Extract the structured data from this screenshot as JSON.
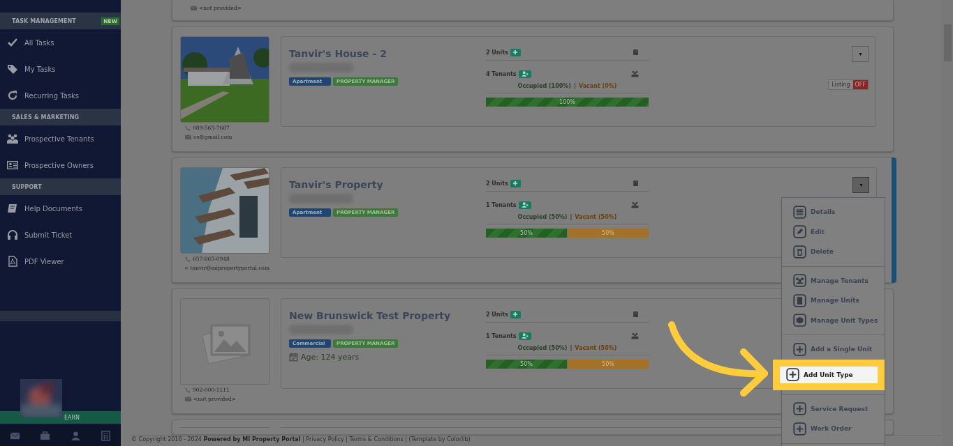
{
  "sidebar": {
    "sections": [
      {
        "heading": "TASK MANAGEMENT",
        "badge": "NEW",
        "items": [
          "All Tasks",
          "My Tasks",
          "Recurring Tasks"
        ]
      },
      {
        "heading": "SALES & MARKETING",
        "items": [
          "Prospective Tenants",
          "Prospective Owners"
        ]
      },
      {
        "heading": "SUPPORT",
        "items": [
          "Help Documents",
          "Submit Ticket",
          "PDF Viewer"
        ]
      }
    ],
    "earn_bar": "EARN"
  },
  "partial_card": {
    "email": "<not provided>"
  },
  "properties": [
    {
      "title": "Tanvir's House - 2",
      "photo": {
        "kind": "picture"
      },
      "phone": "089-565-7687",
      "email": "os@gmail.com",
      "tags": [
        {
          "label": "Apartment",
          "kind": "type"
        },
        {
          "label": "PROPERTY MANAGER",
          "kind": "role"
        }
      ],
      "units": "2 Units",
      "tenants": "4 Tenants",
      "occupied": "Occupied (100%)",
      "separator": "|",
      "vacant": "Vacant (0%)",
      "segments": [
        {
          "label": "100%",
          "kind": "occupied",
          "level": 1
        }
      ],
      "listing": {
        "label": "Listing",
        "state": "OFF"
      },
      "menu_open": false
    },
    {
      "title": "Tanvir's Property",
      "photo": {
        "kind": "picture"
      },
      "phone": "657-865-0948",
      "email": "tanvir@mipropertyportal.com",
      "tags": [
        {
          "label": "Apartment",
          "kind": "type"
        },
        {
          "label": "PROPERTY MANAGER",
          "kind": "role"
        }
      ],
      "units": "2 Units",
      "tenants": "1 Tenants",
      "occupied": "Occupied (50%)",
      "separator": "|",
      "vacant": "Vacant (50%)",
      "segments": [
        {
          "label": "50%",
          "kind": "occupied",
          "level": 0.5
        },
        {
          "label": "50%",
          "kind": "vacant",
          "level": 0.5
        }
      ],
      "menu_open": true
    },
    {
      "title": "New Brunswick Test Property",
      "phone": "902-000-1111",
      "email": "<not provided>",
      "tags": [
        {
          "label": "Commercial",
          "kind": "type"
        },
        {
          "label": "PROPERTY MANAGER",
          "kind": "role"
        }
      ],
      "age": "Age: 124 years",
      "units": "2 Units",
      "tenants": "1 Tenants",
      "occupied": "Occupied (50%)",
      "separator": "|",
      "vacant": "Vacant (50%)",
      "segments": [
        {
          "label": "50%",
          "kind": "occupied",
          "level": 0.5
        },
        {
          "label": "50%",
          "kind": "vacant",
          "level": 0.5
        }
      ]
    }
  ],
  "action_menu": {
    "groups": [
      [
        {
          "label": "Details",
          "selected": false
        },
        {
          "label": "Edit",
          "selected": false
        },
        {
          "label": "Delete",
          "selected": false
        }
      ],
      [
        {
          "label": "Manage Tenants",
          "selected": false
        },
        {
          "label": "Manage Units",
          "selected": false
        },
        {
          "label": "Manage Unit Types",
          "selected": false
        }
      ],
      [
        {
          "label": "Add a Single Unit",
          "selected": false
        },
        {
          "label": "Add Unit Type",
          "selected": true
        }
      ],
      [
        {
          "label": "Service Request",
          "selected": false
        },
        {
          "label": "Work Order",
          "selected": false
        }
      ]
    ]
  },
  "footer": "© Copyright 2016 - 2024 **Powered by MI Property Portal** | Privacy Policy | Terms & Conditions | (Template by Colorlib)"
}
